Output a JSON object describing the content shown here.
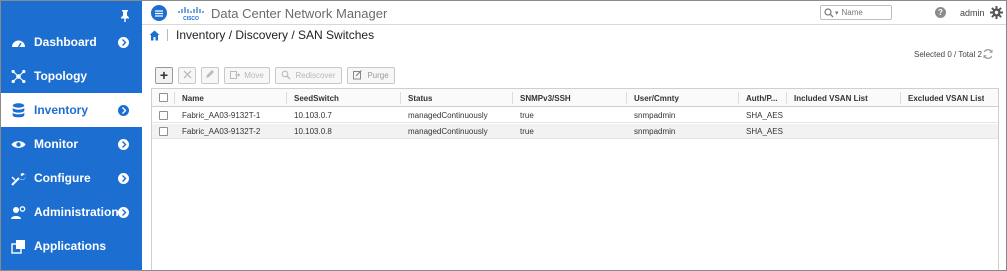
{
  "header": {
    "app_title": "Data Center Network Manager",
    "search_placeholder": "Name",
    "help_icon": "?",
    "user": "admin"
  },
  "sidebar": {
    "items": [
      {
        "label": "Dashboard",
        "icon": "dashboard-icon",
        "active": false
      },
      {
        "label": "Topology",
        "icon": "topology-icon",
        "active": false
      },
      {
        "label": "Inventory",
        "icon": "inventory-icon",
        "active": true
      },
      {
        "label": "Monitor",
        "icon": "monitor-icon",
        "active": false
      },
      {
        "label": "Configure",
        "icon": "configure-icon",
        "active": false
      },
      {
        "label": "Administration",
        "icon": "administration-icon",
        "active": false
      },
      {
        "label": "Applications",
        "icon": "applications-icon",
        "active": false
      }
    ]
  },
  "breadcrumb": "Inventory / Discovery / SAN Switches",
  "selection_info": "Selected 0 / Total 2",
  "toolbar": {
    "add": "+",
    "move": "Move",
    "rediscover": "Rediscover",
    "purge": "Purge"
  },
  "table": {
    "columns": [
      "Name",
      "SeedSwitch",
      "Status",
      "SNMPv3/SSH",
      "User/Cmnty",
      "Auth/P...",
      "Included VSAN List",
      "Excluded VSAN List"
    ],
    "rows": [
      [
        "Fabric_AA03-9132T-1",
        "10.103.0.7",
        "managedContinuously",
        "true",
        "snmpadmin",
        "SHA_AES",
        "",
        ""
      ],
      [
        "Fabric_AA03-9132T-2",
        "10.103.0.8",
        "managedContinuously",
        "true",
        "snmpadmin",
        "SHA_AES",
        "",
        ""
      ]
    ]
  },
  "colors": {
    "sidebar_bg": "#1c6fd1",
    "active_item_bg": "#ffffff",
    "accent": "#1c6fd1"
  }
}
